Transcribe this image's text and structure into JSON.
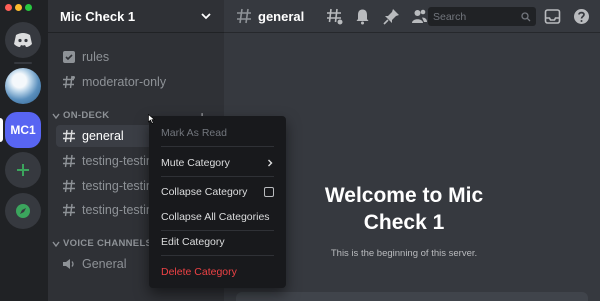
{
  "server": {
    "name": "Mic Check 1",
    "rail_badge": "MC1"
  },
  "channels": {
    "top": [
      {
        "name": "rules",
        "icon": "rules-icon"
      },
      {
        "name": "moderator-only",
        "icon": "hash-icon"
      }
    ],
    "categories": [
      {
        "name": "ON-DECK",
        "items": [
          "general",
          "testing-testing",
          "testing-testing",
          "testing-testing"
        ]
      },
      {
        "name": "VOICE CHANNELS",
        "items": [
          "General"
        ]
      }
    ]
  },
  "topbar": {
    "channel": "general",
    "search_placeholder": "Search"
  },
  "welcome": {
    "title": "Welcome to Mic Check 1",
    "subtitle": "This is the beginning of this server."
  },
  "context_menu": {
    "items": [
      "Mark As Read",
      "Mute Category",
      "Collapse Category",
      "Collapse All Categories",
      "Edit Category",
      "Delete Category"
    ]
  },
  "colors": {
    "accent": "#5865f2",
    "danger": "#ed4245",
    "online_green": "#3ba55d"
  }
}
